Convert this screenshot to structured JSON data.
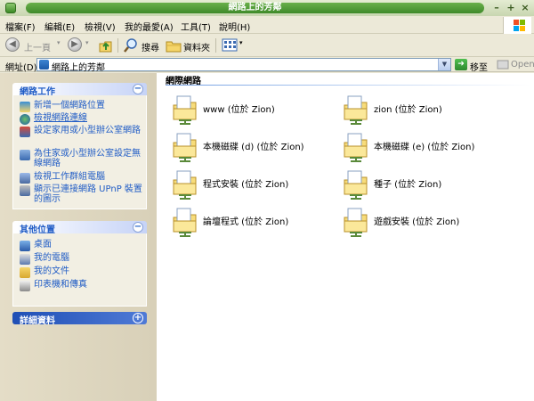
{
  "window": {
    "title": "網路上的芳鄰"
  },
  "menu": [
    "檔案(F)",
    "編輯(E)",
    "檢視(V)",
    "我的最愛(A)",
    "工具(T)",
    "說明(H)"
  ],
  "toolbar": {
    "back": "上一頁",
    "search": "搜尋",
    "folders": "資料夾"
  },
  "address": {
    "label": "網址(D)",
    "value": "網路上的芳鄰",
    "go": "移至",
    "open": "Open"
  },
  "side": {
    "network_tasks": {
      "title": "網路工作",
      "items": [
        "新增一個網路位置",
        "檢視網路連線",
        "設定家用或小型辦公室網路",
        "為住家或小型辦公室設定無線網路",
        "檢視工作群組電腦",
        "顯示已連接網路 UPnP 裝置的圖示"
      ]
    },
    "other_places": {
      "title": "其他位置",
      "items": [
        "桌面",
        "我的電腦",
        "我的文件",
        "印表機和傳真"
      ]
    },
    "details": {
      "title": "詳細資料"
    }
  },
  "main": {
    "group_title": "網際網路",
    "shares": [
      "www (位於 Zion)",
      "zion (位於 Zion)",
      "本機磁碟 (d) (位於 Zion)",
      "本機磁碟 (e) (位於 Zion)",
      "程式安裝 (位於 Zion)",
      "種子 (位於 Zion)",
      "論壇程式 (位於 Zion)",
      "遊戲安裝 (位於 Zion)"
    ]
  }
}
